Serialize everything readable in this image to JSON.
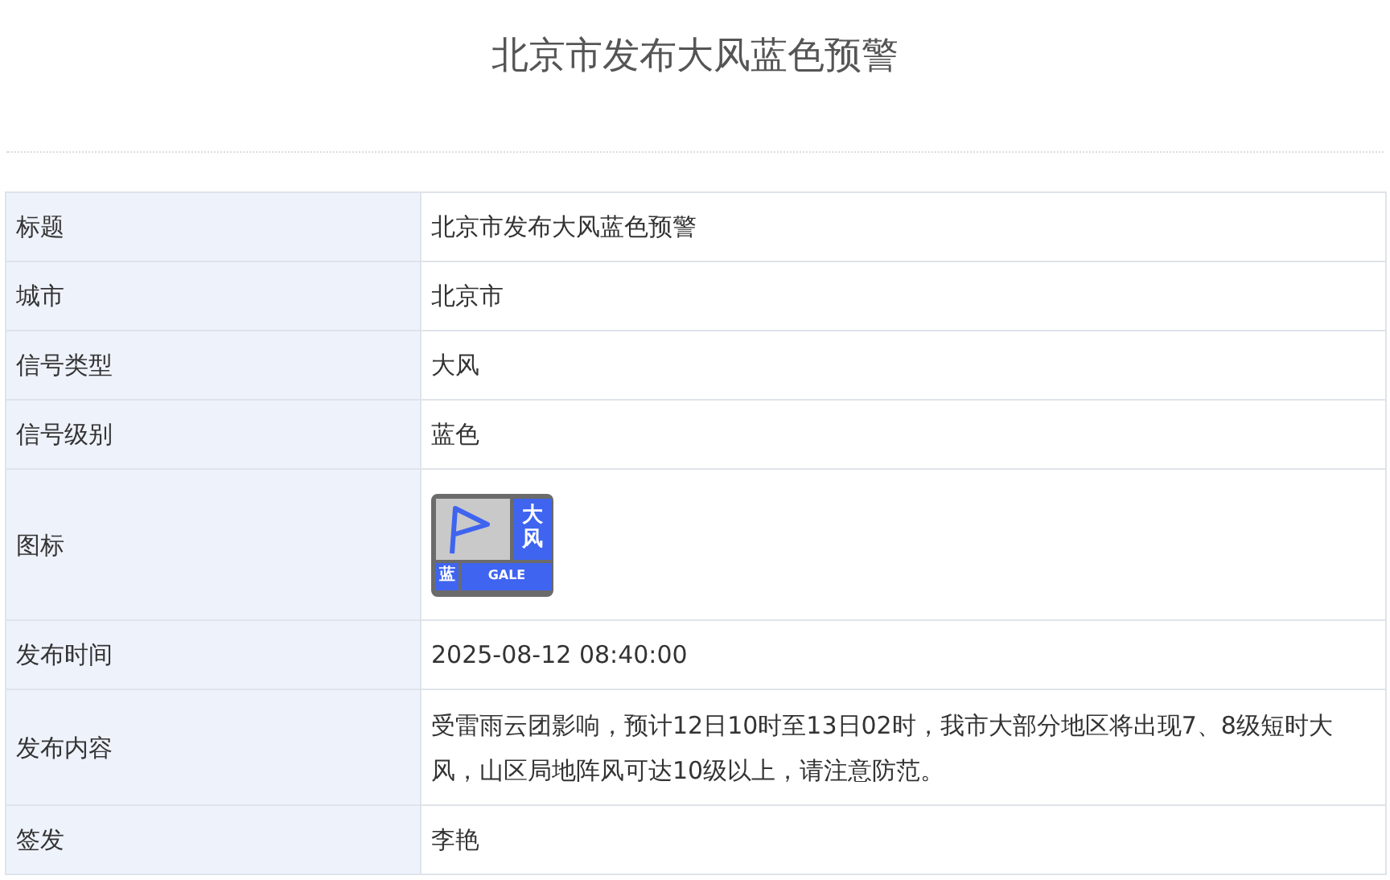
{
  "page_title": "北京市发布大风蓝色预警",
  "rows": [
    {
      "kind": "text",
      "label": "标题",
      "value": "北京市发布大风蓝色预警"
    },
    {
      "kind": "text",
      "label": "城市",
      "value": "北京市"
    },
    {
      "kind": "text",
      "label": "信号类型",
      "value": "大风"
    },
    {
      "kind": "text",
      "label": "信号级别",
      "value": "蓝色"
    },
    {
      "kind": "icon",
      "label": "图标",
      "icon": {
        "type": "大风",
        "level": "蓝",
        "code": "GALE",
        "color": "#3e64f0"
      }
    },
    {
      "kind": "text",
      "label": "发布时间",
      "value": "2025-08-12 08:40:00"
    },
    {
      "kind": "text",
      "label": "发布内容",
      "value": "受雷雨云团影响，预计12日10时至13日02时，我市大部分地区将出现7、8级短时大风，山区局地阵风可达10级以上，请注意防范。"
    },
    {
      "kind": "text",
      "label": "签发",
      "value": "李艳"
    }
  ]
}
